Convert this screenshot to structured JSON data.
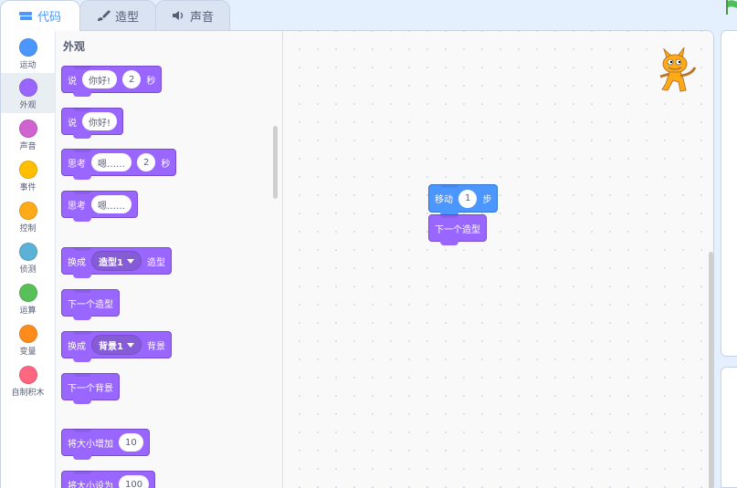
{
  "tabs": [
    {
      "label": "代码",
      "icon": "code-icon",
      "active": true
    },
    {
      "label": "造型",
      "icon": "brush-icon",
      "active": false
    },
    {
      "label": "声音",
      "icon": "speaker-icon",
      "active": false
    }
  ],
  "categories": [
    {
      "label": "运动",
      "color": "#4c97ff"
    },
    {
      "label": "外观",
      "color": "#9966ff"
    },
    {
      "label": "声音",
      "color": "#cf63cf"
    },
    {
      "label": "事件",
      "color": "#ffbf00"
    },
    {
      "label": "控制",
      "color": "#ffab19"
    },
    {
      "label": "侦测",
      "color": "#5cb1d6"
    },
    {
      "label": "运算",
      "color": "#59c059"
    },
    {
      "label": "变量",
      "color": "#ff8c1a"
    },
    {
      "label": "自制积木",
      "color": "#ff6680"
    }
  ],
  "flyout": {
    "title": "外观",
    "blocks": {
      "say_secs": {
        "op": "说",
        "msg": "你好!",
        "num": "2",
        "unit": "秒"
      },
      "say": {
        "op": "说",
        "msg": "你好!"
      },
      "think_secs": {
        "op": "思考",
        "msg": "嗯……",
        "num": "2",
        "unit": "秒"
      },
      "think": {
        "op": "思考",
        "msg": "嗯……"
      },
      "switch_costume": {
        "op": "换成",
        "value": "造型1",
        "suffix": "造型"
      },
      "next_costume": {
        "text": "下一个造型"
      },
      "switch_backdrop": {
        "op": "换成",
        "value": "背景1",
        "suffix": "背景"
      },
      "next_backdrop": {
        "text": "下一个背景"
      },
      "change_size": {
        "op": "将大小增加",
        "num": "10"
      },
      "set_size": {
        "op": "将大小设为",
        "num": "100"
      }
    }
  },
  "workspace": {
    "move": {
      "op": "移动",
      "num": "1",
      "unit": "步"
    },
    "next_costume": {
      "text": "下一个造型"
    }
  },
  "colors": {
    "accent": "#4c97ff",
    "looks": "#9966ff",
    "motion": "#4c97ff"
  }
}
